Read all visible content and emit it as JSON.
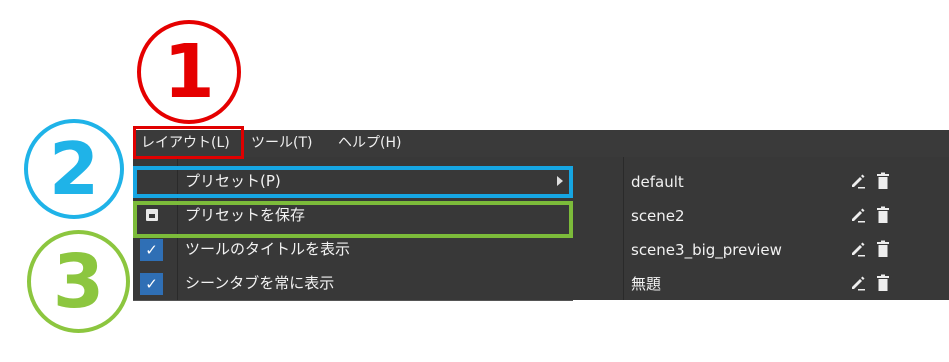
{
  "annotations": {
    "one": "1",
    "two": "2",
    "three": "3"
  },
  "menubar": {
    "layout": "レイアウト(L)",
    "tools": "ツール(T)",
    "help": "ヘルプ(H)"
  },
  "dropdown": {
    "items": [
      {
        "label": "プリセット(P)",
        "icon": "none",
        "submenu_arrow": true
      },
      {
        "label": "プリセットを保存",
        "icon": "save-icon"
      },
      {
        "label": "ツールのタイトルを表示",
        "icon": "checkbox-checked-icon",
        "checked": true
      },
      {
        "label": "シーンタブを常に表示",
        "icon": "checkbox-checked-icon",
        "checked": true
      }
    ]
  },
  "submenu": {
    "presets": [
      {
        "name": "default"
      },
      {
        "name": "scene2"
      },
      {
        "name": "scene3_big_preview"
      },
      {
        "name": "無題"
      }
    ]
  },
  "colors": {
    "menubar_bg": "#3a3a3a",
    "menu_bg": "#383838",
    "check_bg": "#2f6fb5",
    "red": "#e00000",
    "blue": "#16a6e3",
    "green": "#7cbb3a"
  }
}
